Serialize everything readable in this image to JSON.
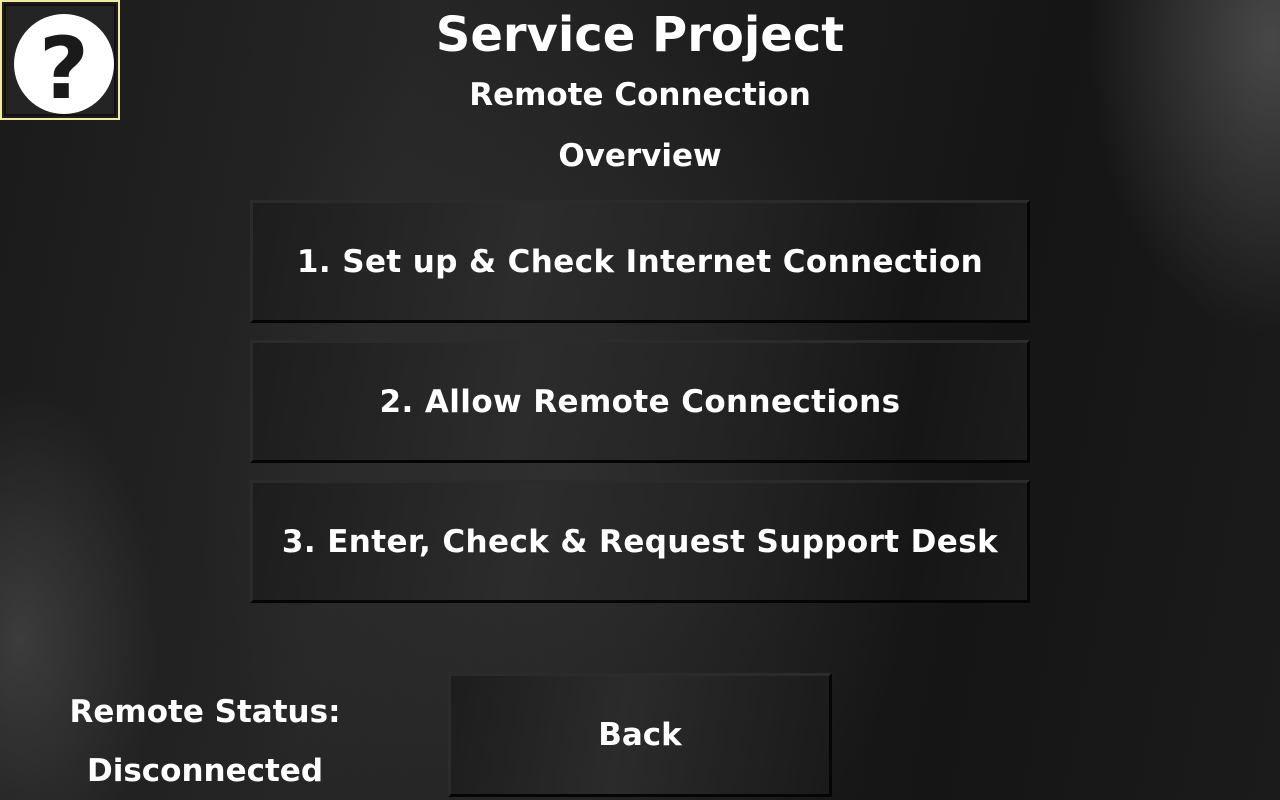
{
  "header": {
    "title": "Service Project",
    "subtitle": "Remote Connection",
    "section": "Overview"
  },
  "help": {
    "icon": "question-circle-icon",
    "glyph": "?",
    "border_color": "#f2e9a0"
  },
  "menu": {
    "items": [
      {
        "label": "1. Set up & Check Internet Connection"
      },
      {
        "label": "2. Allow Remote Connections"
      },
      {
        "label": "3. Enter, Check & Request Support Desk"
      }
    ]
  },
  "status": {
    "label": "Remote Status:",
    "value": "Disconnected"
  },
  "footer": {
    "back_label": "Back"
  }
}
